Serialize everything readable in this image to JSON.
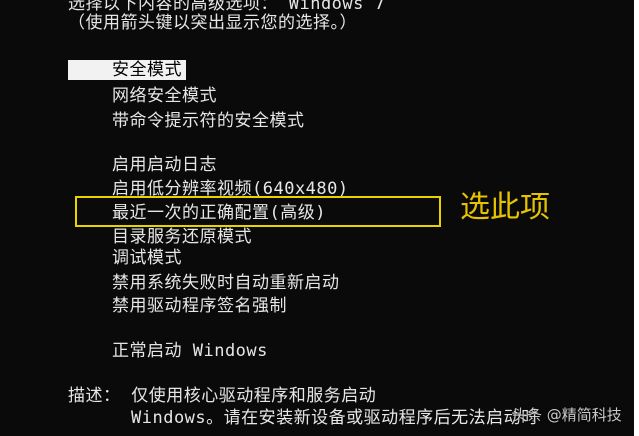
{
  "header": {
    "line1": "选择以下内容的高级选项： Windows 7",
    "line2": "（使用箭头键以突出显示您的选择。）"
  },
  "options": [
    "安全模式",
    "网络安全模式",
    "带命令提示符的安全模式",
    "启用启动日志",
    "启用低分辨率视频(640x480)",
    "最近一次的正确配置(高级)",
    "目录服务还原模式",
    "调试模式",
    "禁用系统失败时自动重新启动",
    "禁用驱动程序签名强制",
    "正常启动 Windows"
  ],
  "selected_option_index": 0,
  "description": {
    "line1": "描述： 仅使用核心驱动程序和服务启动",
    "line2": "Windows。请在安装新设备或驱动程序后无法启动时"
  },
  "annotation": {
    "label": "选此项",
    "color": "#e6c300",
    "box_color": "#e8d200"
  },
  "watermark": "头条 @精简科技",
  "colors": {
    "background": "#0a0a0a",
    "text": "#e6e6e6",
    "selected_bg": "#f2f2f2",
    "selected_text": "#000000"
  }
}
